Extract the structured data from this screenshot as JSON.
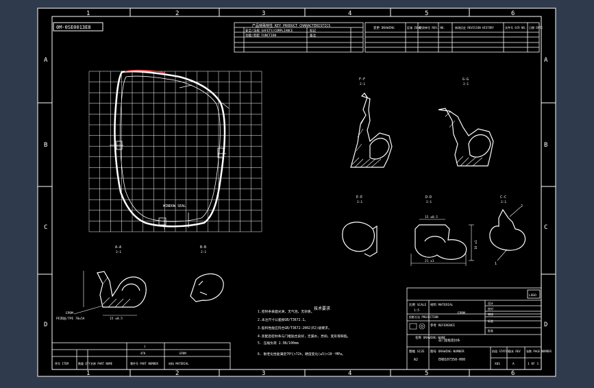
{
  "colors": {
    "bg": "#303a4d",
    "paper": "#000000",
    "line": "#ffffff",
    "accent": "#ff3b3b"
  },
  "frame": {
    "cols": [
      "1",
      "2",
      "3",
      "4",
      "5",
      "6"
    ],
    "rows": [
      "A",
      "B",
      "C",
      "D"
    ]
  },
  "header": {
    "doc_code": "0M-0SE0013E8",
    "product_char": "产品特殊特性 KEY PRODUCT CHARACTERISTICS",
    "safety_reg": "安全/法规 SAFETY/COMPLIANCE",
    "function": "功能/装配 FUNCTION",
    "mark_label": "标记",
    "note_label": "备注",
    "drawing_label": "变更 DRAWING",
    "rev_zone": "区域 ZONE",
    "rev_no": "更改单号 REV. NO.",
    "revision_history": "修改历史 REVISION HISTORY",
    "ecr_no": "文件号 ECR NO.",
    "date": "日期 DATE"
  },
  "views": {
    "main_label": "WINDOW SEAL",
    "ff": {
      "name": "F-F",
      "scale": "2:1"
    },
    "gg": {
      "name": "G-G",
      "scale": "2:1"
    },
    "ee": {
      "name": "E-E",
      "scale": "2:1"
    },
    "dd": {
      "name": "D-D",
      "scale": "2:1"
    },
    "cc": {
      "name": "C-C",
      "scale": "2:1"
    },
    "aa": {
      "name": "A-A",
      "scale": "2:1"
    },
    "bb": {
      "name": "B-B",
      "scale": "2:1"
    },
    "dim_dd_width": "21 ±1",
    "dim_dd_height": "16 ±1",
    "dim_dd_top": "15 ±0.5",
    "dim_aa_bottom": "15 ±0.5",
    "aa_note": "EPDM",
    "aa_note2": "PE涂层/TPE 70±5A",
    "cc_callout_1": "1",
    "cc_callout_2": "2"
  },
  "notes": {
    "title": "技术要求",
    "items": [
      "1.密封条表面光滑，无气泡，无杂质。",
      "2.未注尺寸公差按GB/T3672.1。",
      "3.胶料性能应符合GB/T3672-2002(E2)级要求。",
      "4.装配后密封条与门框贴合良好，无漏水、异响、变形等缺陷。",
      "5. 压缩负荷 2.5N/100mm",
      "6. 耐老化性能满足70℃×72h，硬度变化(±5)×10⁻³MPa。"
    ]
  },
  "title_block": {
    "scale_label": "比例 SCALE",
    "scale_value": "1:5",
    "projection_label": "投影方法 PROJECTION",
    "material_label": "材料 MATERIAL",
    "material_value": "EPDM",
    "reference_label": "参考 REFERENCE",
    "drawing_name_label": "名称 DRAWING NAME",
    "drawing_name_value": "前门窗框密封条",
    "size_label": "图幅 SIZE",
    "size_value": "A2",
    "drawing_number_label": "图号 DRAWING NUMBER",
    "drawing_number_value": "ERB107350-H00",
    "sheet_label": "张数 PAGE NUMBER",
    "sheet_value": "1 OF 1",
    "rev_label": "版本 REV",
    "rev_value": "A",
    "status_label": "阶段 STATUS",
    "status_value": "X01",
    "logo": "LOGO",
    "sign_rows": [
      "设计",
      "校对",
      "审核",
      "标准",
      "批准"
    ]
  },
  "bom": {
    "item_label": "序号 ITEM",
    "qty_label": "数量 QTY",
    "part_name_label": "名称 PART NAME",
    "part_number_label": "零件号 PART NUMBER",
    "material_label": "材料 MATERIAL",
    "part_value": "1",
    "material_value": "EPDM",
    "code_value": "4TK"
  }
}
